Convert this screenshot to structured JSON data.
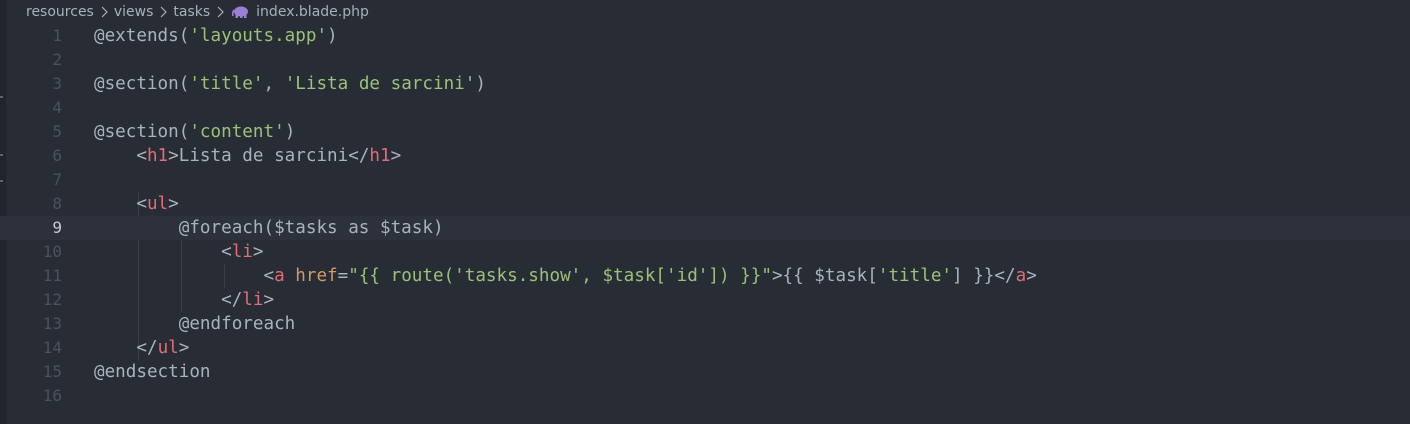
{
  "breadcrumb": {
    "items": [
      "resources",
      "views",
      "tasks"
    ],
    "file": "index.blade.php",
    "file_icon": "php-elephant-icon"
  },
  "colors": {
    "background": "#282c34",
    "line_number": "#495162",
    "current_line_number": "#c8ccd4",
    "current_line_highlight": "#2c313c",
    "tag": "#e06c75",
    "attribute": "#d19a66",
    "string": "#98c379",
    "text": "#abb2bf"
  },
  "editor": {
    "current_line": 9,
    "lines": [
      {
        "n": "1",
        "text": "@extends('layouts.app')"
      },
      {
        "n": "2",
        "text": ""
      },
      {
        "n": "3",
        "text": "@section('title', 'Lista de sarcini')"
      },
      {
        "n": "4",
        "text": ""
      },
      {
        "n": "5",
        "text": "@section('content')"
      },
      {
        "n": "6",
        "text": "    <h1>Lista de sarcini</h1>"
      },
      {
        "n": "7",
        "text": ""
      },
      {
        "n": "8",
        "text": "    <ul>"
      },
      {
        "n": "9",
        "text": "        @foreach($tasks as $task)"
      },
      {
        "n": "10",
        "text": "            <li>"
      },
      {
        "n": "11",
        "text": "                <a href=\"{{ route('tasks.show', $task['id']) }}\">{{ $task['title'] }}</a>"
      },
      {
        "n": "12",
        "text": "            </li>"
      },
      {
        "n": "13",
        "text": "        @endforeach"
      },
      {
        "n": "14",
        "text": "    </ul>"
      },
      {
        "n": "15",
        "text": "@endsection"
      },
      {
        "n": "16",
        "text": ""
      }
    ]
  }
}
